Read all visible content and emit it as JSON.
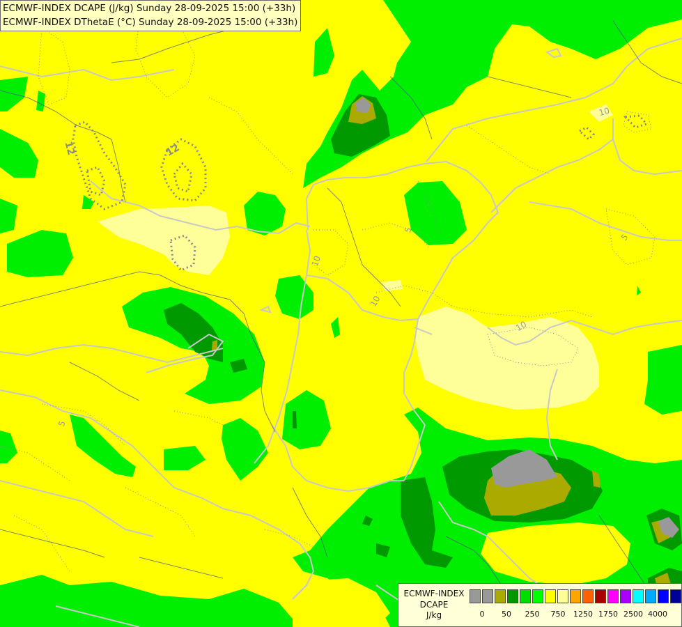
{
  "header": {
    "line1": "ECMWF-INDEX DCAPE (J/kg) Sunday 28-09-2025 15:00 (+33h)",
    "line2": "ECMWF-INDEX DThetaE (°C) Sunday 28-09-2025 15:00 (+33h)"
  },
  "legend": {
    "name_line1": "ECMWF-INDEX",
    "name_line2": "DCAPE",
    "unit": "J/kg",
    "colors": [
      "#999999",
      "#999999",
      "#aaaa00",
      "#009900",
      "#00dd00",
      "#00ff00",
      "#ffff00",
      "#ffff99",
      "#ffa500",
      "#ff6000",
      "#aa0000",
      "#ff00ff",
      "#aa00ff",
      "#00ffff",
      "#00aaff",
      "#0000ff",
      "#000099"
    ],
    "ticks": [
      "0",
      "50",
      "250",
      "750",
      "1250",
      "1750",
      "2500",
      "4000"
    ]
  },
  "contour_labels": [
    "12",
    "12",
    "10",
    "10",
    "10",
    "10",
    "5",
    "5",
    "5"
  ]
}
